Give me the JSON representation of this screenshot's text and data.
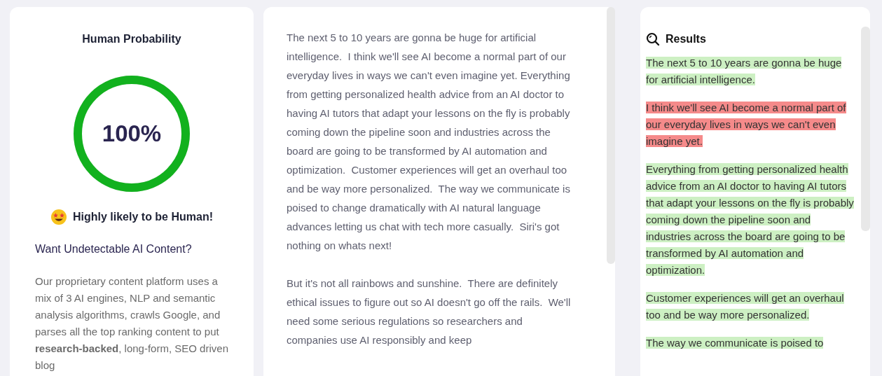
{
  "probability_card": {
    "title": "Human Probability",
    "gauge": {
      "level": 1,
      "reading": "100%"
    },
    "verdict": "Highly likely to be Human!",
    "promo_heading": "Want Undetectable AI Content?",
    "promo_text": "Our proprietary content platform uses a mix of 3 AI engines, NLP and semantic analysis algorithms, crawls Google, and parses all the top ranking content to put **research-backed**, long-form, SEO driven blog"
  },
  "editor": {
    "paragraphs": [
      "The next 5 to 10 years are gonna be huge for artificial intelligence.  I think we'll see AI become a normal part of our everyday lives in ways we can't even imagine yet. Everything from getting personalized health advice from an AI doctor to having AI tutors that adapt your lessons on the fly is probably coming down the pipeline soon and industries across the board are going to be transformed by AI automation and optimization.  Customer experiences will get an overhaul too and be way more personalized.  The way we communicate is poised to change dramatically with AI natural language advances letting us chat with tech more casually.  Siri's got nothing on whats next!",
      "But it's not all rainbows and sunshine.  There are definitely ethical issues to figure out so AI doesn't go off the rails.  We'll need some serious regulations so researchers and companies use AI responsibly and keep"
    ]
  },
  "results": {
    "title": "Results",
    "sentences": [
      {
        "text": "The next 5 to 10 years are gonna be huge for artificial intelligence.",
        "kind": "human"
      },
      {
        "text": "I think we'll see AI become a normal part of our everyday lives in ways we can't even imagine yet.",
        "kind": "ai"
      },
      {
        "text": "Everything from getting personalized health advice from an AI doctor to having AI tutors that adapt your lessons on the fly is probably coming down the pipeline soon and industries across the board are going to be transformed by AI automation and optimization.",
        "kind": "human"
      },
      {
        "text": "Customer experiences will get an overhaul too and be way more personalized.",
        "kind": "human"
      },
      {
        "text": "The way we communicate is poised to",
        "kind": "human"
      }
    ]
  }
}
